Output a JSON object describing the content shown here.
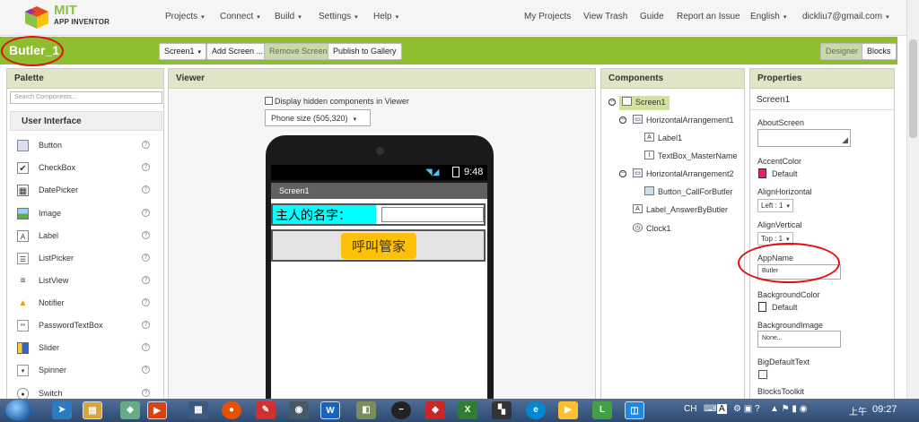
{
  "logo": {
    "mit": "MIT",
    "sub": "APP INVENTOR"
  },
  "nav": {
    "left": [
      "Projects",
      "Connect",
      "Build",
      "Settings",
      "Help"
    ],
    "my_projects": "My Projects",
    "view_trash": "View Trash",
    "guide": "Guide",
    "report": "Report an Issue",
    "language": "English",
    "account": "dickliu7@gmail.com"
  },
  "toolbar": {
    "project_name": "Butler_1",
    "screen_select": "Screen1",
    "add_screen": "Add Screen ...",
    "remove_screen": "Remove Screen",
    "publish": "Publish to Gallery",
    "designer": "Designer",
    "blocks": "Blocks"
  },
  "palette": {
    "title": "Palette",
    "search_placeholder": "Search Components...",
    "category": "User Interface",
    "items": [
      "Button",
      "CheckBox",
      "DatePicker",
      "Image",
      "Label",
      "ListPicker",
      "ListView",
      "Notifier",
      "PasswordTextBox",
      "Slider",
      "Spinner",
      "Switch"
    ]
  },
  "viewer": {
    "title": "Viewer",
    "display_hidden": "Display hidden components in Viewer",
    "phone_size": "Phone size (505,320)",
    "time": "9:48",
    "screen_title": "Screen1",
    "label_master": "主人的名字：",
    "call_button": "呼叫管家"
  },
  "components": {
    "title": "Components",
    "tree": [
      "Screen1",
      "HorizontalArrangement1",
      "Label1",
      "TextBox_MasterName",
      "HorizontalArrangement2",
      "Button_CallForButler",
      "Label_AnswerByButler",
      "Clock1"
    ]
  },
  "properties": {
    "title": "Properties",
    "screen": "Screen1",
    "about_screen": "AboutScreen",
    "accent_color": "AccentColor",
    "accent_value": "Default",
    "accent_hex": "#e91e63",
    "align_h": "AlignHorizontal",
    "align_h_value": "Left : 1",
    "align_v": "AlignVertical",
    "align_v_value": "Top : 1",
    "app_name": "AppName",
    "app_name_value": "Butler",
    "bg_color": "BackgroundColor",
    "bg_color_value": "Default",
    "bg_image": "BackgroundImage",
    "bg_image_value": "None...",
    "big_default": "BigDefaultText",
    "blocks_toolkit": "BlocksToolkit"
  },
  "taskbar": {
    "lang": "CH",
    "ime": "A",
    "period": "上午",
    "clock": "09:27"
  }
}
